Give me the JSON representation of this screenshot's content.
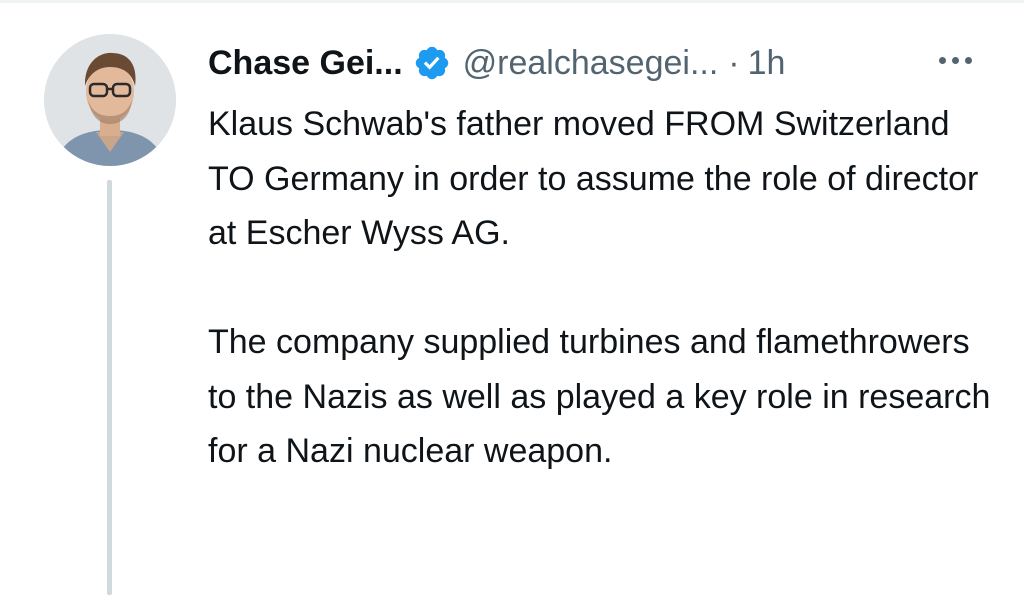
{
  "tweet": {
    "author_name": "Chase Gei...",
    "handle": "@realchasegei...",
    "separator": "·",
    "timestamp": "1h",
    "paragraphs": [
      "Klaus Schwab's father moved FROM Switzerland TO Germany in order to assume the role of director at Escher Wyss AG.",
      "The company supplied turbines and flamethrowers to the Nazis as well as played a key role in research for a Nazi nuclear weapon."
    ]
  },
  "icons": {
    "verified": "verified-badge-icon",
    "more": "more-horizontal-icon"
  },
  "colors": {
    "verified_blue": "#1d9bf0",
    "secondary_text": "#536471",
    "primary_text": "#0f1419",
    "thread_line": "#cfd9de"
  }
}
